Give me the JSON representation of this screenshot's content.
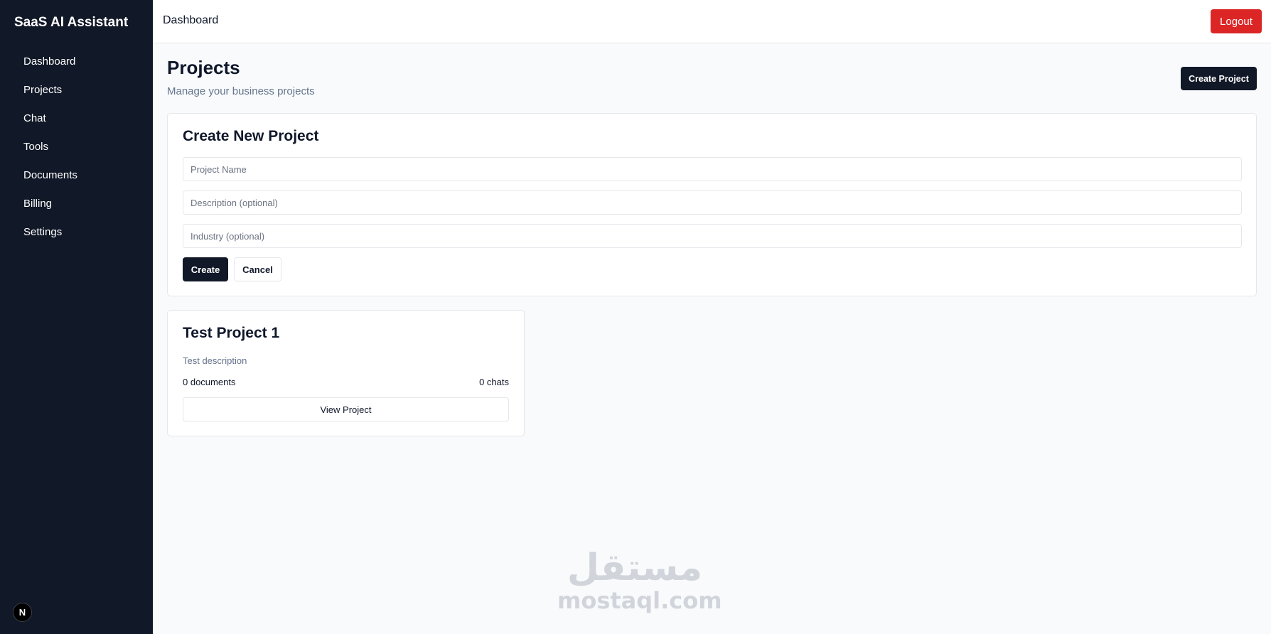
{
  "sidebar": {
    "brand": "SaaS AI Assistant",
    "items": [
      {
        "label": "Dashboard"
      },
      {
        "label": "Projects"
      },
      {
        "label": "Chat"
      },
      {
        "label": "Tools"
      },
      {
        "label": "Documents"
      },
      {
        "label": "Billing"
      },
      {
        "label": "Settings"
      }
    ],
    "badge": "N"
  },
  "header": {
    "title": "Dashboard",
    "logout_label": "Logout"
  },
  "page": {
    "title": "Projects",
    "subtitle": "Manage your business projects",
    "create_button": "Create Project"
  },
  "form": {
    "title": "Create New Project",
    "name_placeholder": "Project Name",
    "description_placeholder": "Description (optional)",
    "industry_placeholder": "Industry (optional)",
    "create_label": "Create",
    "cancel_label": "Cancel"
  },
  "projects": [
    {
      "name": "Test Project 1",
      "description": "Test description",
      "documents": "0 documents",
      "chats": "0 chats",
      "view_label": "View Project"
    }
  ],
  "watermark": {
    "arabic": "مستقل",
    "latin": "mostaql.com"
  },
  "colors": {
    "sidebar_bg": "#111827",
    "primary_button": "#111827",
    "logout_button": "#dc2626",
    "page_bg": "#f8fafc"
  }
}
